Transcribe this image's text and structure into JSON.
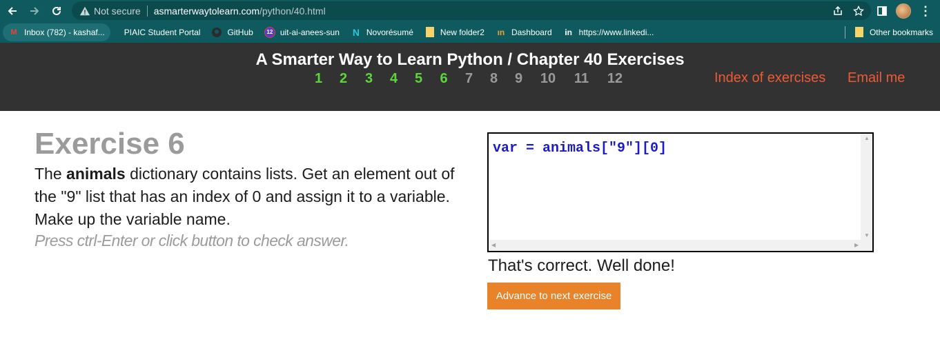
{
  "browser": {
    "security_label": "Not secure",
    "url_host": "asmarterwaytolearn.com",
    "url_path": "/python/40.html"
  },
  "bookmarks": [
    {
      "label": "Inbox (782) - kashaf...",
      "icon": "gmail-icon"
    },
    {
      "label": "PIAIC Student Portal",
      "icon": "blank-icon"
    },
    {
      "label": "GitHub",
      "icon": "github-icon"
    },
    {
      "label": "uit-ai-anees-sun",
      "icon": "badge-icon",
      "badge": "12"
    },
    {
      "label": "Novorésumé",
      "icon": "novoresume-icon"
    },
    {
      "label": "New folder2",
      "icon": "folder-icon"
    },
    {
      "label": "Dashboard",
      "icon": "dashboard-icon"
    },
    {
      "label": "https://www.linkedi...",
      "icon": "linkedin-icon"
    }
  ],
  "other_bookmarks": "Other bookmarks",
  "header": {
    "title": "A Smarter Way to Learn Python / Chapter 40 Exercises",
    "chapters_done": [
      "1",
      "2",
      "3",
      "4",
      "5",
      "6"
    ],
    "chapters_todo": [
      "7",
      "8",
      "9",
      "10",
      "11",
      "12"
    ],
    "index_link": "Index of exercises",
    "email_link": "Email me"
  },
  "exercise": {
    "title": "Exercise 6",
    "text_before": "The ",
    "text_bold": "animals",
    "text_after": " dictionary contains lists. Get an element out of the \"9\" list that has an index of 0 and assign it to a variable. Make up the variable name.",
    "hint": "Press ctrl-Enter or click button to check answer."
  },
  "editor": {
    "code": "var = animals[\"9\"][0]"
  },
  "result": {
    "feedback": "That's correct. Well done!",
    "advance_label": "Advance to next exercise"
  },
  "colors": {
    "chrome": "#0f5a5e",
    "header_bg": "#323232",
    "done_chapter": "#5cd63c",
    "link": "#ee5a35",
    "button": "#e8832a"
  }
}
